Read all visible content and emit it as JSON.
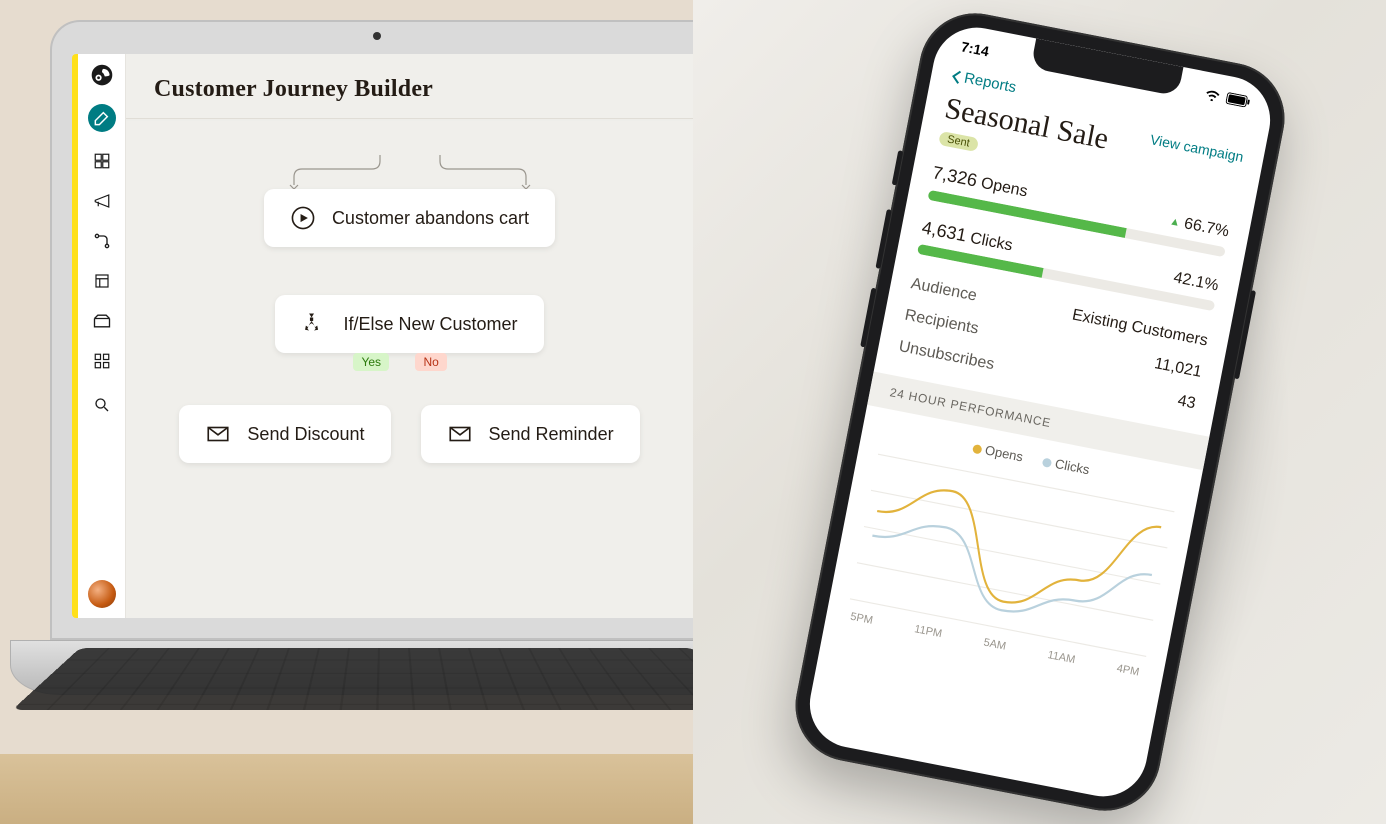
{
  "laptop": {
    "page_title": "Customer Journey Builder",
    "trigger": {
      "label": "Customer abandons cart"
    },
    "condition": {
      "label": "If/Else New Customer",
      "yes_tag": "Yes",
      "no_tag": "No"
    },
    "action_yes": {
      "label": "Send Discount"
    },
    "action_no": {
      "label": "Send Reminder"
    }
  },
  "phone": {
    "status_time": "7:14",
    "back_label": "Reports",
    "campaign_title": "Seasonal Sale",
    "view_campaign": "View campaign",
    "status_badge": "Sent",
    "opens": {
      "count": "7,326",
      "label": "Opens",
      "pct": "66.7%",
      "bar_pct": 66.7
    },
    "clicks": {
      "count": "4,631",
      "label": "Clicks",
      "pct": "42.1%",
      "bar_pct": 42.1
    },
    "kv": {
      "audience_k": "Audience",
      "audience_v": "Existing Customers",
      "recipients_k": "Recipients",
      "recipients_v": "11,021",
      "unsubs_k": "Unsubscribes",
      "unsubs_v": "43"
    },
    "section_header": "24 HOUR PERFORMANCE",
    "legend": {
      "opens": "Opens",
      "clicks": "Clicks"
    }
  },
  "chart_data": {
    "type": "line",
    "x": [
      "5PM",
      "11PM",
      "5AM",
      "11AM",
      "4PM"
    ],
    "series": [
      {
        "name": "Opens",
        "color": "#e2b33c",
        "values": [
          62,
          85,
          18,
          42,
          88
        ]
      },
      {
        "name": "Clicks",
        "color": "#b9d1dd",
        "values": [
          45,
          60,
          12,
          28,
          55
        ]
      }
    ],
    "xlabel": "",
    "ylabel": "",
    "ylim": [
      0,
      100
    ]
  }
}
